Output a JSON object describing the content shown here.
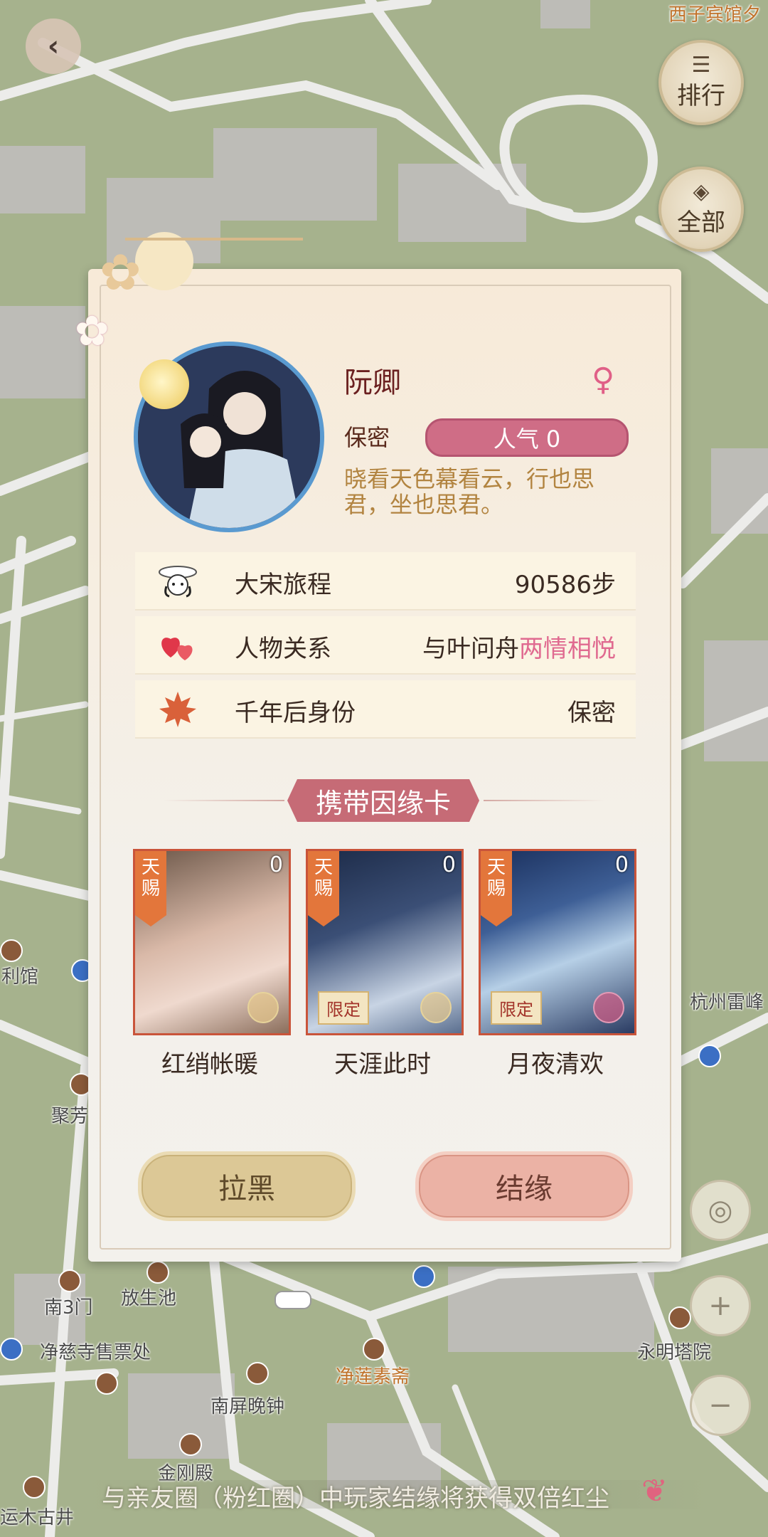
{
  "top_nav": {
    "ranking_label": "排行",
    "all_label": "全部"
  },
  "map_labels": {
    "hotel": "西子宾馆夕",
    "leifeng": "杭州雷峰",
    "lili": "利馆",
    "jufang": "聚芳",
    "south_gate": "南3门",
    "fangsheng": "放生池",
    "ticket": "净慈寺售票处",
    "jinglian": "净莲素斋",
    "yongming": "永明塔院",
    "nanping": "南屏晚钟",
    "jingang": "金刚殿",
    "yunmu": "运木古井"
  },
  "profile": {
    "name": "阮卿",
    "gender_text": "保密",
    "popularity": "人气 0",
    "signature": "晓看天色幕看云，行也思君，坐也思君。"
  },
  "info_rows": [
    {
      "label": "大宋旅程",
      "value": "90586步",
      "icon": "traveler-icon"
    },
    {
      "label": "人物关系",
      "value_prefix": "与叶问舟",
      "value_highlight": "两情相悦",
      "icon": "hearts-icon"
    },
    {
      "label": "千年后身份",
      "value": "保密",
      "icon": "maple-leaf-icon"
    }
  ],
  "cards_section": {
    "title": "携带因缘卡",
    "cards": [
      {
        "name": "红绡帐暖",
        "tag": "天赐",
        "count": "0",
        "limited": ""
      },
      {
        "name": "天涯此时",
        "tag": "天赐",
        "count": "0",
        "limited": "限定"
      },
      {
        "name": "月夜清欢",
        "tag": "天赐",
        "count": "0",
        "limited": "限定"
      }
    ]
  },
  "actions": {
    "block_label": "拉黑",
    "bond_label": "结缘"
  },
  "notice": "与亲友圈（粉红圈）中玩家结缘将获得双倍红尘",
  "colors": {
    "map_green": "#a8b48f",
    "road": "#e9e9e6",
    "popularity_pink": "#cf6d86",
    "highlight_pink": "#e06a90",
    "card_border": "#c9543a"
  }
}
